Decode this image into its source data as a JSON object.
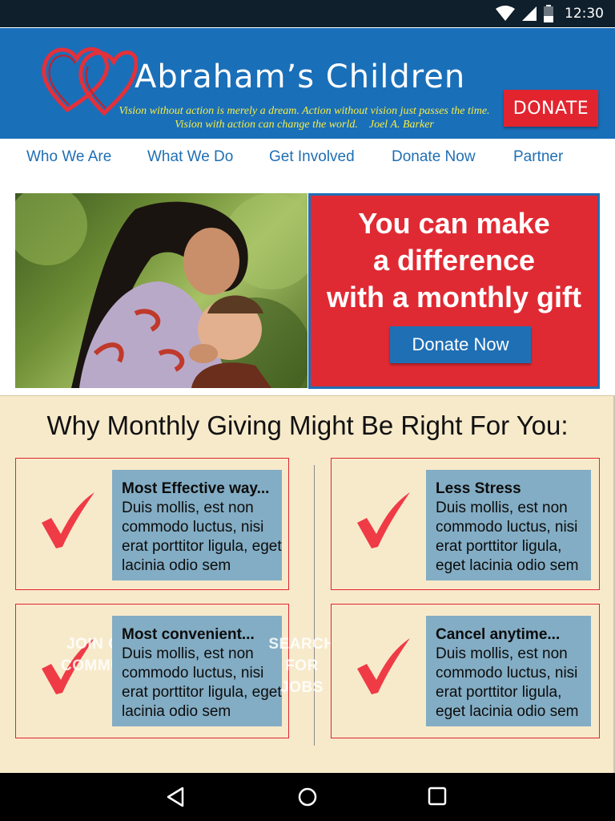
{
  "status_bar": {
    "time": "12:30"
  },
  "header": {
    "title": "Abraham’s Children",
    "tagline_line1": "Vision without action is merely a dream. Action without vision just passes the time.",
    "tagline_line2": "Vision with action can change the world.    Joel A. Barker",
    "donate_label": "DONATE"
  },
  "nav": {
    "items": [
      {
        "label": "Who We Are"
      },
      {
        "label": "What We Do"
      },
      {
        "label": "Get Involved"
      },
      {
        "label": "Donate Now"
      },
      {
        "label": "Partner"
      }
    ]
  },
  "hero": {
    "headline": [
      "You can make",
      "a difference",
      "with a monthly gift"
    ],
    "button_label": "Donate Now"
  },
  "why": {
    "title": "Why Monthly Giving Might Be Right For You:",
    "cards": [
      {
        "heading": "Most Effective way...",
        "body": "Duis mollis, est non commodo luctus, nisi erat porttitor ligula, eget lacinia odio sem"
      },
      {
        "heading": "Less Stress",
        "body": "Duis mollis, est non commodo luctus, nisi erat porttitor ligula, eget lacinia odio sem"
      },
      {
        "heading": "Most convenient...",
        "body": "Duis mollis, est non commodo luctus, nisi erat porttitor ligula, eget lacinia odio sem"
      },
      {
        "heading": "Cancel anytime...",
        "body": "Duis mollis, est non commodo luctus, nisi erat porttitor ligula, eget lacinia odio sem"
      }
    ],
    "overlay_text_1": "JOIN OUR COMMUNITY",
    "overlay_text_2": "SEARCH FOR JOBS"
  },
  "colors": {
    "header_blue": "#1a6fb9",
    "accent_red": "#e2242f",
    "tagline_yellow": "#f6ed44",
    "section_cream": "#f7eacb",
    "card_text_bg": "#83adc4"
  },
  "icons": {
    "status": [
      "wifi-icon",
      "signal-icon",
      "battery-icon"
    ],
    "logo": "heart-logo-icon",
    "check": "checkmark-icon",
    "system_nav": [
      "back-icon",
      "home-icon",
      "recents-icon"
    ]
  }
}
